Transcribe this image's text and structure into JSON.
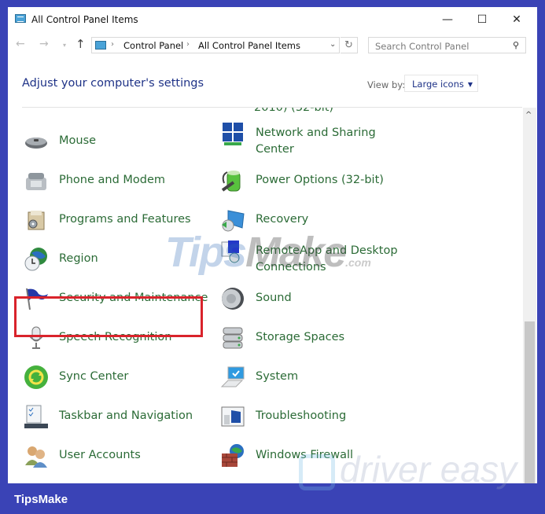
{
  "window": {
    "title": "All Control Panel Items",
    "controls": {
      "minimize": "—",
      "maximize": "☐",
      "close": "✕"
    }
  },
  "navigation": {
    "back": "←",
    "forward": "→",
    "recent": "▾",
    "up": "↑",
    "breadcrumb": [
      "Control Panel",
      "All Control Panel Items"
    ],
    "breadcrumb_separator": "›",
    "dropdown": "⌄",
    "refresh": "↻"
  },
  "search": {
    "placeholder": "Search Control Panel",
    "value": "",
    "icon": "⚲"
  },
  "header": {
    "heading": "Adjust your computer's settings",
    "view_by_label": "View by:",
    "view_by_value": "Large icons",
    "view_by_caret": "▼"
  },
  "items": {
    "partial_top_right": "2010) (32-bit)",
    "left": [
      {
        "label": "Mouse",
        "icon": "mouse-icon"
      },
      {
        "label": "Phone and Modem",
        "icon": "phone-modem-icon"
      },
      {
        "label": "Programs and Features",
        "icon": "programs-features-icon",
        "highlighted": true
      },
      {
        "label": "Region",
        "icon": "region-icon"
      },
      {
        "label": "Security and Maintenance",
        "icon": "security-flag-icon"
      },
      {
        "label": "Speech Recognition",
        "icon": "microphone-icon"
      },
      {
        "label": "Sync Center",
        "icon": "sync-icon"
      },
      {
        "label": "Taskbar and Navigation",
        "icon": "taskbar-icon"
      },
      {
        "label": "User Accounts",
        "icon": "user-accounts-icon"
      }
    ],
    "right": [
      {
        "label": "Network and Sharing Center",
        "icon": "network-icon"
      },
      {
        "label": "Power Options (32-bit)",
        "icon": "power-options-icon"
      },
      {
        "label": "Recovery",
        "icon": "recovery-icon"
      },
      {
        "label": "RemoteApp and Desktop Connections",
        "icon": "remoteapp-icon"
      },
      {
        "label": "Sound",
        "icon": "sound-icon"
      },
      {
        "label": "Storage Spaces",
        "icon": "storage-icon"
      },
      {
        "label": "System",
        "icon": "system-icon"
      },
      {
        "label": "Troubleshooting",
        "icon": "troubleshooting-icon"
      },
      {
        "label": "Windows Firewall",
        "icon": "firewall-icon"
      }
    ]
  },
  "scrollbar": {
    "up_arrow": "^"
  },
  "watermarks": {
    "tipsmake_a": "Tips",
    "tipsmake_b": "Make",
    "tipsmake_com": ".com",
    "driver_easy": "driver easy"
  },
  "footer": {
    "brand": "TipsMake"
  },
  "colors": {
    "frame": "#3a43b6",
    "link_green": "#2b6b36",
    "heading_blue": "#1e3287",
    "highlight_red": "#d9232b"
  }
}
